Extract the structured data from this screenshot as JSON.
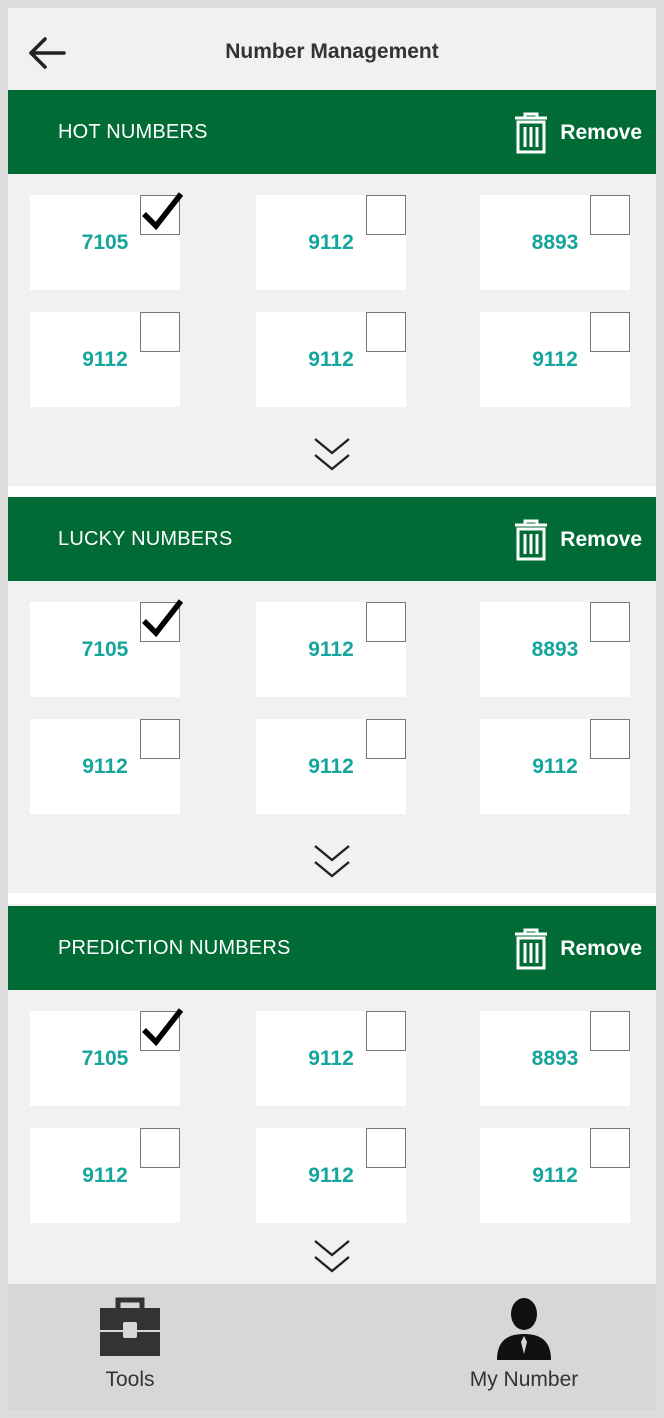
{
  "header": {
    "title": "Number Management",
    "back_icon": "arrow-left-icon"
  },
  "sections": [
    {
      "title": "HOT NUMBERS",
      "remove_label": "Remove",
      "tiles": [
        {
          "number": "7105",
          "checked": true
        },
        {
          "number": "9112",
          "checked": false
        },
        {
          "number": "8893",
          "checked": false
        },
        {
          "number": "9112",
          "checked": false
        },
        {
          "number": "9112",
          "checked": false
        },
        {
          "number": "9112",
          "checked": false
        }
      ]
    },
    {
      "title": "LUCKY NUMBERS",
      "remove_label": "Remove",
      "tiles": [
        {
          "number": "7105",
          "checked": true
        },
        {
          "number": "9112",
          "checked": false
        },
        {
          "number": "8893",
          "checked": false
        },
        {
          "number": "9112",
          "checked": false
        },
        {
          "number": "9112",
          "checked": false
        },
        {
          "number": "9112",
          "checked": false
        }
      ]
    },
    {
      "title": "PREDICTION NUMBERS",
      "remove_label": "Remove",
      "tiles": [
        {
          "number": "7105",
          "checked": true
        },
        {
          "number": "9112",
          "checked": false
        },
        {
          "number": "8893",
          "checked": false
        },
        {
          "number": "9112",
          "checked": false
        },
        {
          "number": "9112",
          "checked": false
        },
        {
          "number": "9112",
          "checked": false
        }
      ]
    }
  ],
  "tabbar": {
    "tools_label": "Tools",
    "tools_icon": "toolbox-icon",
    "my_number_label": "My Number",
    "my_number_icon": "user-icon"
  },
  "colors": {
    "section_bar": "#016b36",
    "number_text": "#16a59d",
    "background": "#f1f1f1",
    "tabbar": "#d7d7d7"
  }
}
